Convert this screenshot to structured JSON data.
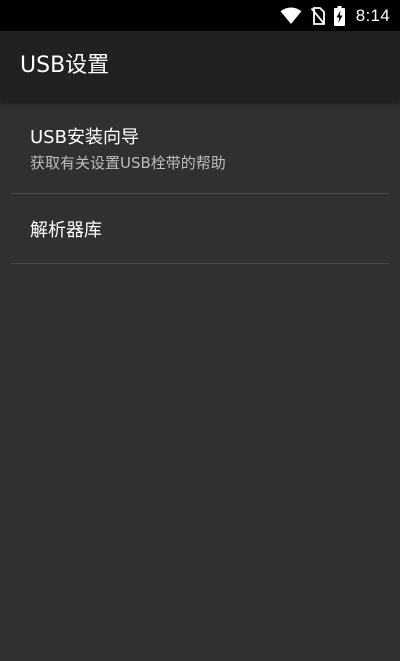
{
  "status_bar": {
    "time": "8:14",
    "icons": [
      "wifi-icon",
      "no-sim-icon",
      "battery-charging-icon"
    ]
  },
  "app_bar": {
    "title": "USB设置"
  },
  "preferences": [
    {
      "title": "USB安装向导",
      "summary": "获取有关设置USB栓带的帮助"
    },
    {
      "title": "解析器库"
    }
  ],
  "colors": {
    "status_bar_bg": "#000000",
    "app_bar_bg": "#212121",
    "content_bg": "#303030",
    "divider": "#484848",
    "primary_text": "#ffffff",
    "secondary_text": "#bdbdbd"
  }
}
